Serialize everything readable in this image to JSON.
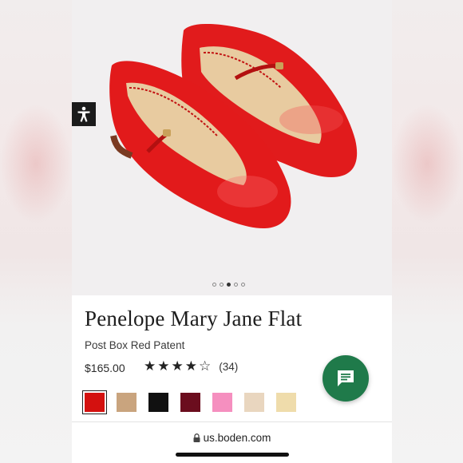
{
  "product": {
    "title": "Penelope Mary Jane Flat",
    "color_name": "Post Box Red Patent",
    "price": "$165.00",
    "rating": 4,
    "rating_max": 5,
    "review_count": "(34)",
    "stars": [
      "★",
      "★",
      "★",
      "★",
      "☆"
    ]
  },
  "gallery": {
    "image_count": 5,
    "active_index": 2
  },
  "swatches": [
    {
      "color": "#d4110f",
      "selected": true
    },
    {
      "color": "#c9a47e"
    },
    {
      "color": "#111111"
    },
    {
      "color": "#6b0d1e"
    },
    {
      "color": "#f58fbf"
    },
    {
      "color": "#e9d6bf"
    },
    {
      "color": "#efdcab"
    }
  ],
  "browser": {
    "url": "us.boden.com"
  },
  "icons": {
    "accessibility": "accessibility-icon",
    "chat": "chat-icon",
    "lock": "lock-icon"
  },
  "colors": {
    "chat_button": "#1f7a4a",
    "shoe": "#e0191a"
  }
}
